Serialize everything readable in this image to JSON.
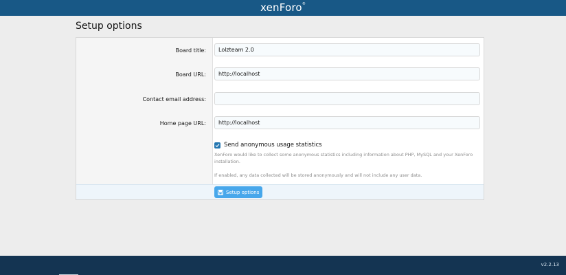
{
  "header": {
    "logo_text": "xenForo"
  },
  "page": {
    "title": "Setup options"
  },
  "form": {
    "board_title": {
      "label": "Board title:",
      "value": "Lolzteam 2.0"
    },
    "board_url": {
      "label": "Board URL:",
      "value": "http://localhost"
    },
    "contact_email": {
      "label": "Contact email address:",
      "value": ""
    },
    "home_page_url": {
      "label": "Home page URL:",
      "value": "http://localhost"
    },
    "stats": {
      "label": "Send anonymous usage statistics",
      "checked": true,
      "hint_1": "XenForo would like to collect some anonymous statistics including information about PHP, MySQL and your XenForo installation.",
      "hint_2": "If enabled, any data collected will be stored anonymously and will not include any user data."
    },
    "submit_label": "Setup options"
  },
  "footer": {
    "version": "v2.2.13"
  },
  "colors": {
    "header": "#185886",
    "footer": "#143452",
    "button": "#47a7eb",
    "checkbox": "#2577b1"
  },
  "icons": {
    "checkbox": "check-icon",
    "submit": "save-icon"
  }
}
